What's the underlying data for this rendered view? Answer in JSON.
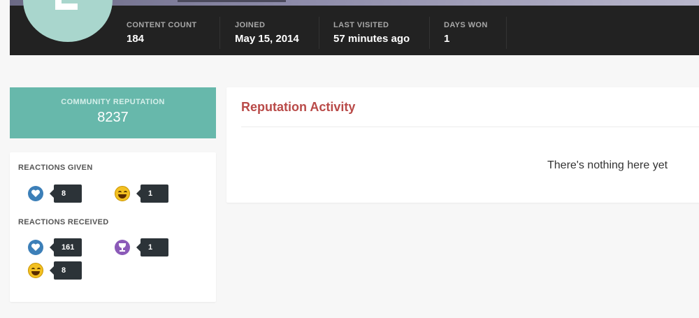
{
  "profile": {
    "avatar_letter": "L",
    "stats": [
      {
        "label": "CONTENT COUNT",
        "value": "184"
      },
      {
        "label": "JOINED",
        "value": "May 15, 2014"
      },
      {
        "label": "LAST VISITED",
        "value": "57 minutes ago"
      },
      {
        "label": "DAYS WON",
        "value": "1"
      }
    ]
  },
  "reputation": {
    "label": "COMMUNITY REPUTATION",
    "value": "8237",
    "color": "#67b8ab"
  },
  "reactions": {
    "given_title": "REACTIONS GIVEN",
    "given": [
      {
        "icon": "heart-icon",
        "count": "8"
      },
      {
        "icon": "haha-icon",
        "count": "1"
      }
    ],
    "received_title": "REACTIONS RECEIVED",
    "received": [
      {
        "icon": "heart-icon",
        "count": "161"
      },
      {
        "icon": "trophy-icon",
        "count": "1"
      },
      {
        "icon": "haha-icon",
        "count": "8"
      }
    ]
  },
  "activity": {
    "title": "Reputation Activity",
    "empty_message": "There's nothing here yet",
    "title_color": "#b94a48"
  }
}
